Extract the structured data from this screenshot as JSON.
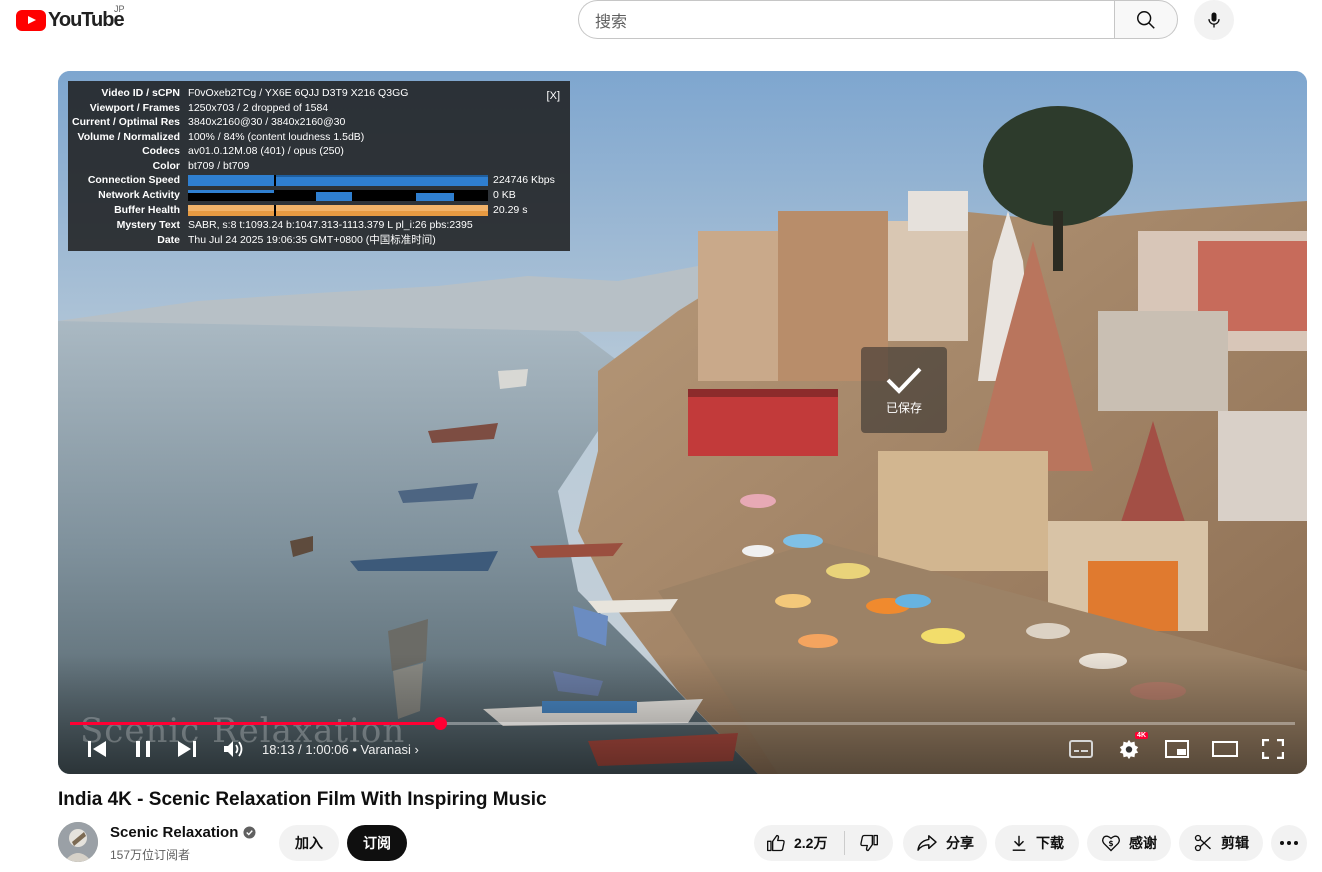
{
  "masthead": {
    "logo_text": "YouTube",
    "region": "JP",
    "search_placeholder": "搜索",
    "search_icon": "search-icon",
    "mic_icon": "mic-icon"
  },
  "stats": {
    "close_label": "[X]",
    "rows": [
      {
        "label": "Video ID / sCPN",
        "value": "F0vOxeb2TCg  /  YX6E  6QJJ  D3T9  X216  Q3GG"
      },
      {
        "label": "Viewport / Frames",
        "value": "1250x703 / 2 dropped of 1584"
      },
      {
        "label": "Current / Optimal Res",
        "value": "3840x2160@30 / 3840x2160@30"
      },
      {
        "label": "Volume / Normalized",
        "value": "100% / 84% (content loudness 1.5dB)"
      },
      {
        "label": "Codecs",
        "value": "av01.0.12M.08 (401) / opus (250)"
      },
      {
        "label": "Color",
        "value": "bt709 / bt709"
      }
    ],
    "graphs": [
      {
        "label": "Connection Speed",
        "value": "224746 Kbps"
      },
      {
        "label": "Network Activity",
        "value": "0 KB"
      },
      {
        "label": "Buffer Health",
        "value": "20.29 s"
      }
    ],
    "tail_rows": [
      {
        "label": "Mystery Text",
        "value": "SABR, s:8 t:1093.24 b:1047.313-1113.379 L pl_i:26 pbs:2395"
      },
      {
        "label": "Date",
        "value": "Thu Jul 24 2025 19:06:35 GMT+0800 (中国标准时间)"
      }
    ]
  },
  "player": {
    "saved_label": "已保存",
    "watermark": "Scenic Relaxation",
    "time": "18:13 / 1:00:06",
    "chapter": "Varanasi",
    "progress": 0.302,
    "badge_4k": "4K"
  },
  "video": {
    "title": "India 4K - Scenic Relaxation Film With Inspiring Music",
    "channel_name": "Scenic Relaxation",
    "subscriber_count": "157万位订阅者",
    "join_label": "加入",
    "subscribe_label": "订阅",
    "like_count": "2.2万",
    "share_label": "分享",
    "download_label": "下载",
    "thanks_label": "感谢",
    "clip_label": "剪辑"
  },
  "colors": {
    "brand_red": "#ff0000",
    "progress_red": "#ff0033",
    "connection_graph": "#2f7fd0",
    "buffer_graph": "#f2b36a"
  }
}
